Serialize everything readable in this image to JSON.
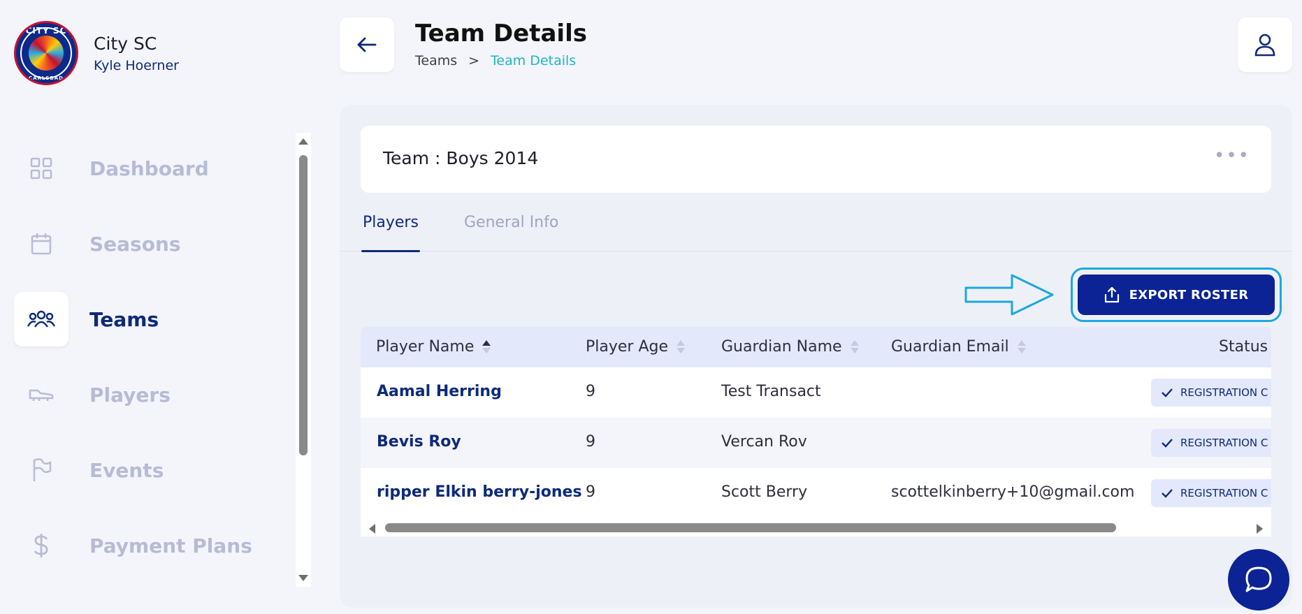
{
  "brand": {
    "logo_top": "CITY SC",
    "logo_bottom": "CARLSBAD",
    "name": "City SC",
    "user": "Kyle Hoerner"
  },
  "nav": {
    "items": [
      {
        "label": "Dashboard",
        "icon": "grid-icon",
        "active": false
      },
      {
        "label": "Seasons",
        "icon": "calendar-icon",
        "active": false
      },
      {
        "label": "Teams",
        "icon": "users-icon",
        "active": true
      },
      {
        "label": "Players",
        "icon": "cleat-icon",
        "active": false
      },
      {
        "label": "Events",
        "icon": "flag-icon",
        "active": false
      },
      {
        "label": "Payment Plans",
        "icon": "dollar-icon",
        "active": false
      }
    ]
  },
  "header": {
    "title": "Team Details",
    "breadcrumb": {
      "root": "Teams",
      "separator": ">",
      "current": "Team Details"
    }
  },
  "team": {
    "prefix": "Team : ",
    "name": "Boys 2014",
    "more_label": "•••"
  },
  "tabs": [
    {
      "label": "Players",
      "active": true
    },
    {
      "label": "General Info",
      "active": false
    }
  ],
  "export": {
    "label": "EXPORT ROSTER"
  },
  "table": {
    "columns": [
      "Player Name",
      "Player Age",
      "Guardian Name",
      "Guardian Email",
      "Status"
    ],
    "sorted_column": "Player Name",
    "sort_direction": "ascending",
    "rows": [
      {
        "player_name": "Aamal Herring",
        "player_age": "9",
        "guardian_name": "Test Transact",
        "guardian_email": "",
        "status": "REGISTRATION C"
      },
      {
        "player_name": "Bevis Roy",
        "player_age": "9",
        "guardian_name": "Vercan Rov",
        "guardian_email": "",
        "status": "REGISTRATION C"
      },
      {
        "player_name": "ripper Elkin berry-jones",
        "player_age": "9",
        "guardian_name": "Scott Berry",
        "guardian_email": "scottelkinberry+10@gmail.com",
        "status": "REGISTRATION C"
      }
    ]
  },
  "colors": {
    "primary": "#0b2394",
    "navy_text": "#0d2a7a",
    "accent_teal": "#1fb5c2",
    "highlight": "#1aa8e0",
    "nav_inactive": "#b7bbd4"
  }
}
